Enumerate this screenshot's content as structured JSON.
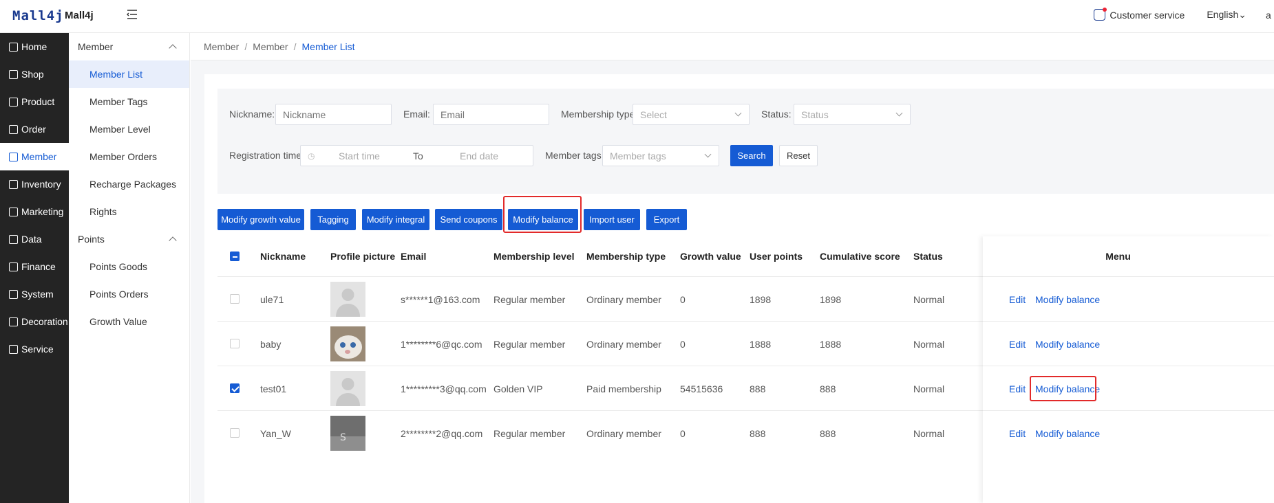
{
  "header": {
    "logo": "Mall4j",
    "app_name": "Mall4j",
    "customer_service": "Customer service",
    "language": "English",
    "user_initial": "a"
  },
  "sidebar_main": [
    {
      "label": "Home",
      "icon": "home-icon"
    },
    {
      "label": "Shop",
      "icon": "shop-icon"
    },
    {
      "label": "Product",
      "icon": "product-icon"
    },
    {
      "label": "Order",
      "icon": "order-icon"
    },
    {
      "label": "Member",
      "icon": "member-icon",
      "active": true
    },
    {
      "label": "Inventory",
      "icon": "inventory-icon"
    },
    {
      "label": "Marketing",
      "icon": "marketing-icon"
    },
    {
      "label": "Data",
      "icon": "data-icon"
    },
    {
      "label": "Finance",
      "icon": "finance-icon"
    },
    {
      "label": "System",
      "icon": "system-icon"
    },
    {
      "label": "Decoration",
      "icon": "decoration-icon"
    },
    {
      "label": "Service",
      "icon": "service-icon"
    }
  ],
  "sidebar_sub": {
    "group1": "Member",
    "group1_items": [
      "Member List",
      "Member Tags",
      "Member Level",
      "Member Orders",
      "Recharge Packages",
      "Rights"
    ],
    "group2": "Points",
    "group2_items": [
      "Points Goods",
      "Points Orders",
      "Growth Value"
    ]
  },
  "breadcrumb": [
    "Member",
    "Member",
    "Member List"
  ],
  "filters": {
    "nickname_label": "Nickname:",
    "nickname_placeholder": "Nickname",
    "email_label": "Email:",
    "email_placeholder": "Email",
    "membership_type_label": "Membership type:",
    "membership_type_placeholder": "Select",
    "status_label": "Status:",
    "status_placeholder": "Status",
    "registration_label": "Registration time:",
    "start_placeholder": "Start time",
    "range_sep": "To",
    "end_placeholder": "End date",
    "tags_label": "Member tags:",
    "tags_placeholder": "Member tags",
    "search": "Search",
    "reset": "Reset"
  },
  "actions": [
    "Modify growth value",
    "Tagging",
    "Modify integral",
    "Send coupons",
    "Modify balance",
    "Import user",
    "Export"
  ],
  "table": {
    "headers": [
      "Nickname",
      "Profile picture",
      "Email",
      "Membership level",
      "Membership type",
      "Growth value",
      "User points",
      "Cumulative score",
      "Status",
      "Menu"
    ],
    "rows": [
      {
        "nickname": "ule71",
        "email": "s******1@163.com",
        "level": "Regular member",
        "type": "Ordinary member",
        "growth": "0",
        "points": "1898",
        "score": "1898",
        "status": "Normal",
        "checked": false,
        "pic": "default"
      },
      {
        "nickname": "baby",
        "email": "1********6@qc.com",
        "level": "Regular member",
        "type": "Ordinary member",
        "growth": "0",
        "points": "1888",
        "score": "1888",
        "status": "Normal",
        "checked": false,
        "pic": "cat"
      },
      {
        "nickname": "test01",
        "email": "1*********3@qq.com",
        "level": "Golden VIP",
        "type": "Paid membership",
        "growth": "54515636",
        "points": "888",
        "score": "888",
        "status": "Normal",
        "checked": true,
        "pic": "default"
      },
      {
        "nickname": "Yan_W",
        "email": "2********2@qq.com",
        "level": "Regular member",
        "type": "Ordinary member",
        "growth": "0",
        "points": "888",
        "score": "888",
        "status": "Normal",
        "checked": false,
        "pic": "photo"
      }
    ],
    "edit_label": "Edit",
    "modify_balance_label": "Modify balance"
  },
  "colors": {
    "accent": "#155bd4",
    "highlight": "#e22a2a",
    "sidebar": "#242424"
  }
}
